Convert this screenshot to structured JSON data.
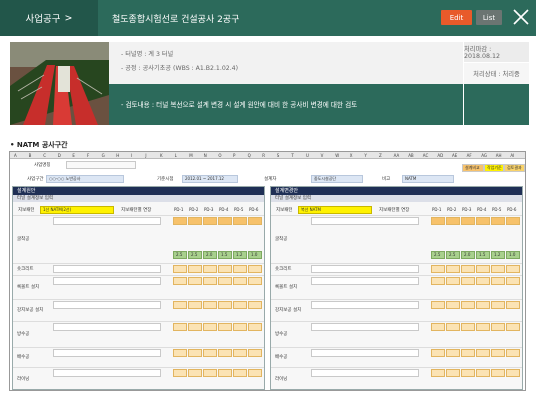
{
  "header": {
    "breadcrumb": "사업공구",
    "breadcrumb_chevron": ">",
    "title": "철도종합시험선로 건설공사 2공구",
    "edit_label": "Edit",
    "list_label": "List"
  },
  "info": {
    "tunnel": "- 터널명 : 계 3 터널",
    "process": "- 공정 : 공사기초공 (WBS : A1.B2.1.02.4)",
    "review": "- 검토내용 : 터널 복선으로 설계 변경 시 설계 원안에 대비 한 공사비 변경에 대한 검토",
    "deadline": "처리마감 : 2018.08.12",
    "status": "처리상태 : 처리중"
  },
  "section_title": "• NATM 공사구간",
  "sheet": {
    "columns": [
      "A",
      "B",
      "C",
      "D",
      "E",
      "F",
      "G",
      "H",
      "I",
      "J",
      "K",
      "L",
      "M",
      "N",
      "O",
      "P",
      "Q",
      "R",
      "S",
      "T",
      "U",
      "V",
      "W",
      "X",
      "Y",
      "Z",
      "AA",
      "AB",
      "AC",
      "AD",
      "AE",
      "AF",
      "AG",
      "AH",
      "AI"
    ],
    "top_label": "사업명칭",
    "row2": [
      "사업구간",
      "○○-○○ 노반공사",
      "기준시점",
      "2012.01 ~ 2017.12",
      "설계자",
      "중도시설공단",
      "비고",
      "NATM"
    ],
    "legend": [
      "설계비교",
      "작업기준",
      "검토결과"
    ],
    "left_pane": {
      "title": "설계원안",
      "subtitle": "터널 설계정보 입력",
      "type_label": "지보패턴",
      "type_value": "1선 NATM(2선)",
      "excav_label": "지보패턴별 연장",
      "groups": [
        "굴착공",
        "숏크리트",
        "록볼트 설치",
        "강지보공 설치",
        "방수공",
        "배수공",
        "라이닝"
      ],
      "values": [
        "PD-1",
        "PD-2",
        "PD-3",
        "PD-4",
        "PD-5",
        "PD-6",
        "2.5",
        "2.5",
        "2.0",
        "1.5",
        "1.2",
        "1.0"
      ]
    },
    "right_pane": {
      "title": "설계변경안",
      "subtitle": "터널 설계정보 입력",
      "type_label": "지보패턴",
      "type_value": "복선 NATM",
      "excav_label": "지보패턴별 연장",
      "groups": [
        "굴착공",
        "숏크리트",
        "록볼트 설치",
        "강지보공 설치",
        "방수공",
        "배수공",
        "라이닝"
      ],
      "values": [
        "PD-1",
        "PD-2",
        "PD-3",
        "PD-4",
        "PD-5",
        "PD-6",
        "2.5",
        "2.5",
        "2.0",
        "1.5",
        "1.2",
        "1.0"
      ]
    }
  }
}
